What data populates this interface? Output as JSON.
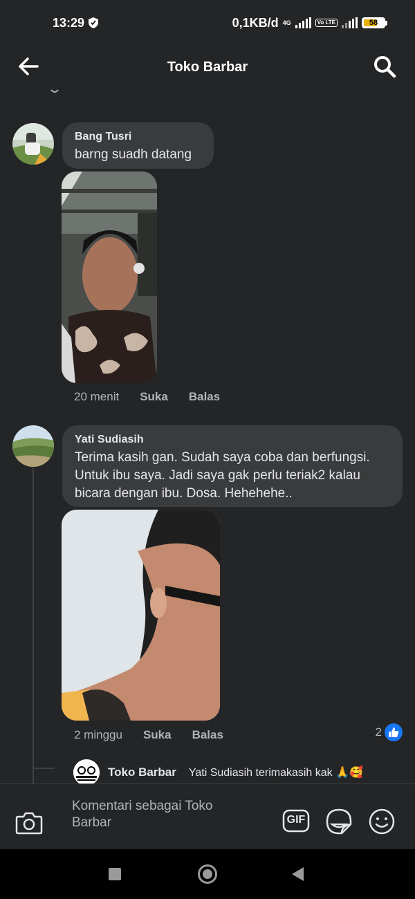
{
  "status_bar": {
    "time": "13:29",
    "network_speed": "0,1KB/d",
    "network_type": "4G",
    "volte": "Vo LTE",
    "battery": "58"
  },
  "header": {
    "title": "Toko Barbar"
  },
  "comments": [
    {
      "author": "Bang Tusri",
      "text": "barng suadh datang",
      "time": "20 menit",
      "like_label": "Suka",
      "reply_label": "Balas"
    },
    {
      "author": "Yati Sudiasih",
      "text": "Terima kasih gan. Sudah saya coba dan berfungsi. Untuk ibu saya. Jadi saya gak perlu teriak2 kalau bicara dengan ibu. Dosa. Hehehehe..",
      "time": "2 minggu",
      "like_label": "Suka",
      "reply_label": "Balas",
      "reaction_count": "2"
    }
  ],
  "reply": {
    "author": "Toko Barbar",
    "text": "Yati Sudiasih terimakasih kak 🙏🥰"
  },
  "composer": {
    "placeholder": "Komentari sebagai Toko Barbar",
    "gif_label": "GIF"
  },
  "colors": {
    "background": "#242526",
    "bubble": "#3a3b3c",
    "like_blue": "#1877f2"
  }
}
